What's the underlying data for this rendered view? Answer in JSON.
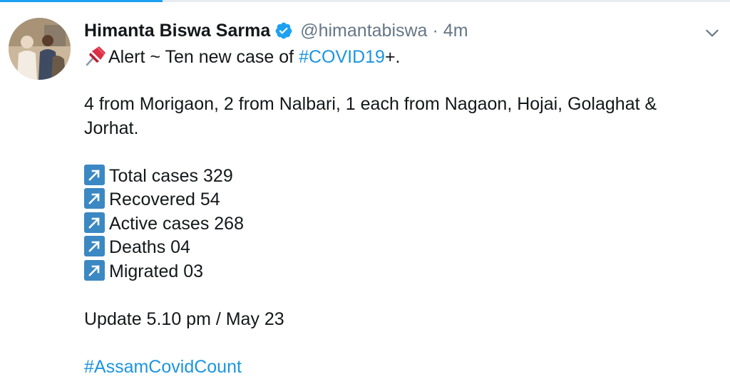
{
  "user": {
    "name": "Himanta Biswa Sarma",
    "handle": "@himantabiswa",
    "separator": "·",
    "time": "4m"
  },
  "tweet": {
    "alert_prefix": "Alert ~  Ten new case of ",
    "alert_hashtag": "#COVID19",
    "alert_suffix": "+.",
    "districts": "4 from Morigaon, 2 from Nalbari, 1 each from Nagaon, Hojai, Golaghat &",
    "districts_cont": "Jorhat.",
    "stats": [
      {
        "label": "Total cases 329"
      },
      {
        "label": "Recovered 54"
      },
      {
        "label": "Active cases 268"
      },
      {
        "label": "Deaths 04"
      },
      {
        "label": "Migrated 03"
      }
    ],
    "update": "Update 5.10 pm / May 23",
    "hashtag": "#AssamCovidCount"
  },
  "icons": {
    "verified": "verified-badge-icon",
    "caret": "chevron-down-icon",
    "pin": "pushpin-icon",
    "arrow": "up-right-arrow-icon"
  },
  "colors": {
    "accent": "#1da1f2",
    "link": "#1b95e0",
    "muted": "#657786",
    "arrow_box": "#3b88c3",
    "pin_red": "#dd2e44"
  }
}
